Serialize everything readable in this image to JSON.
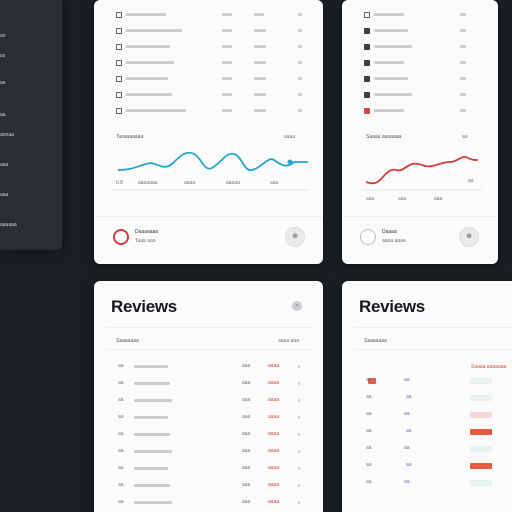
{
  "sidebar": {
    "items": [
      {
        "label": "an"
      },
      {
        "label": "as"
      },
      {
        "label": "ae"
      },
      {
        "label": "aa"
      },
      {
        "label": "annaa"
      },
      {
        "label": "aaa"
      },
      {
        "label": "aaa"
      },
      {
        "label": "aaaaaa"
      }
    ]
  },
  "card_a": {
    "chart_label": "Tasaaaaaaa",
    "chart_value": "aaaa",
    "axis_ticks": [
      "0.8",
      "aaaaaaa",
      "aaaa",
      "aaaaa",
      "aaa"
    ],
    "footer_title": "Daaaaaaa",
    "footer_sub": "Taaa  aaa",
    "footer_button": "⊕",
    "line_color": "#23a7c9"
  },
  "card_b": {
    "chart_label": "Saaaa aaaaaaa",
    "chart_value": "aa",
    "axis_ticks": [
      "aaa",
      "aaa",
      "aaa",
      "aa"
    ],
    "footer_title": "Daaaa",
    "footer_sub": "aaaa  aaaa",
    "footer_button": "⊕",
    "line_color": "#d23c3c"
  },
  "reviews_left": {
    "title": "Reviews",
    "subheader_left": "Saaaaaaa",
    "subheader_right": "aaaa  aaa",
    "rows": [
      {
        "id": "aa",
        "date": "aaa",
        "status": "aaaa"
      },
      {
        "id": "aa",
        "date": "aaa",
        "status": "aaaa"
      },
      {
        "id": "aa",
        "date": "aaa",
        "status": "aaaa"
      },
      {
        "id": "aa",
        "date": "aaa",
        "status": "aaaa"
      },
      {
        "id": "aa",
        "date": "aaa",
        "status": "aaaa"
      },
      {
        "id": "aa",
        "date": "aaa",
        "status": "aaaa"
      },
      {
        "id": "aa",
        "date": "aaa",
        "status": "aaaa"
      },
      {
        "id": "aa",
        "date": "aaa",
        "status": "aaaa"
      },
      {
        "id": "aa",
        "date": "aaa",
        "status": "aaaa"
      }
    ]
  },
  "reviews_right": {
    "title": "Reviews",
    "subheader_left": "Saaaaaaa",
    "subheader_right": "Saaaa  aaaaaaa",
    "rows": [
      {
        "a": "aa",
        "b": "aa"
      },
      {
        "a": "aa",
        "b": "aa"
      },
      {
        "a": "aa",
        "b": "aa"
      },
      {
        "a": "aa",
        "b": "aa"
      },
      {
        "a": "aa",
        "b": "aa"
      },
      {
        "a": "aa",
        "b": "aa"
      },
      {
        "a": "aa",
        "b": "aa"
      }
    ]
  }
}
